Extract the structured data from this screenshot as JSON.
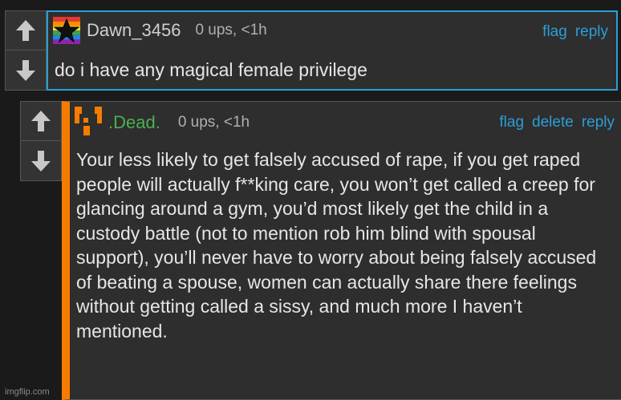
{
  "comment1": {
    "username": "Dawn_3456",
    "ups": "0 ups, <1h",
    "actions": [
      "flag",
      "reply"
    ],
    "body": "do i have any magical female privilege",
    "avatar_icon": "rainbow-star-icon"
  },
  "comment2": {
    "username": ".Dead.",
    "ups": "0 ups, <1h",
    "actions": [
      "flag",
      "delete",
      "reply"
    ],
    "body": "Your less likely to get falsely accused of rape, if you get raped people will actually f**king care, you won’t get called a creep for glancing around a gym, you’d most likely get the child in a custody battle (not to mention rob him blind with spousal support), you’ll never have to worry about being falsely accused of beating a spouse, women can actually share there feelings without getting called a sissy, and much more I haven’t mentioned.",
    "avatar_icon": "orange-pixel-face-icon"
  },
  "watermark": "imgflip.com",
  "colors": {
    "link": "#2a9fd6",
    "accent_orange": "#f57c00",
    "username_green": "#4caf50",
    "background": "#1a1a1a",
    "card": "#2e2e2e"
  }
}
